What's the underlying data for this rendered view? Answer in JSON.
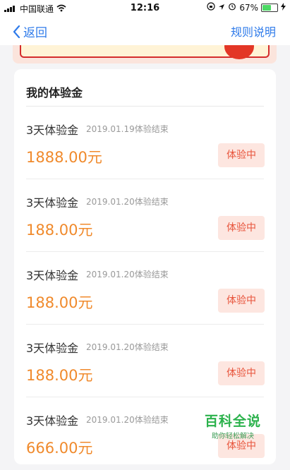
{
  "status_bar": {
    "carrier": "中国联通",
    "time": "12:16",
    "battery_percent": "67%",
    "battery_level": 0.67
  },
  "nav": {
    "back_label": "返回",
    "rules_label": "规则说明"
  },
  "card": {
    "title": "我的体验金",
    "items": [
      {
        "name": "3天体验金",
        "date": "2019.01.19体验结束",
        "amount": "1888.00元",
        "status": "体验中"
      },
      {
        "name": "3天体验金",
        "date": "2019.01.20体验结束",
        "amount": "188.00元",
        "status": "体验中"
      },
      {
        "name": "3天体验金",
        "date": "2019.01.20体验结束",
        "amount": "188.00元",
        "status": "体验中"
      },
      {
        "name": "3天体验金",
        "date": "2019.01.20体验结束",
        "amount": "188.00元",
        "status": "体验中"
      },
      {
        "name": "3天体验金",
        "date": "2019.01.20体验结束",
        "amount": "666.00元",
        "status": "体验中"
      }
    ]
  },
  "watermark": {
    "title": "百科全说",
    "subtitle": "助你轻松解决"
  },
  "colors": {
    "accent_blue": "#2f7bea",
    "amount_orange": "#f08a2c",
    "badge_bg": "#fde6e0",
    "badge_text": "#e8533a"
  }
}
